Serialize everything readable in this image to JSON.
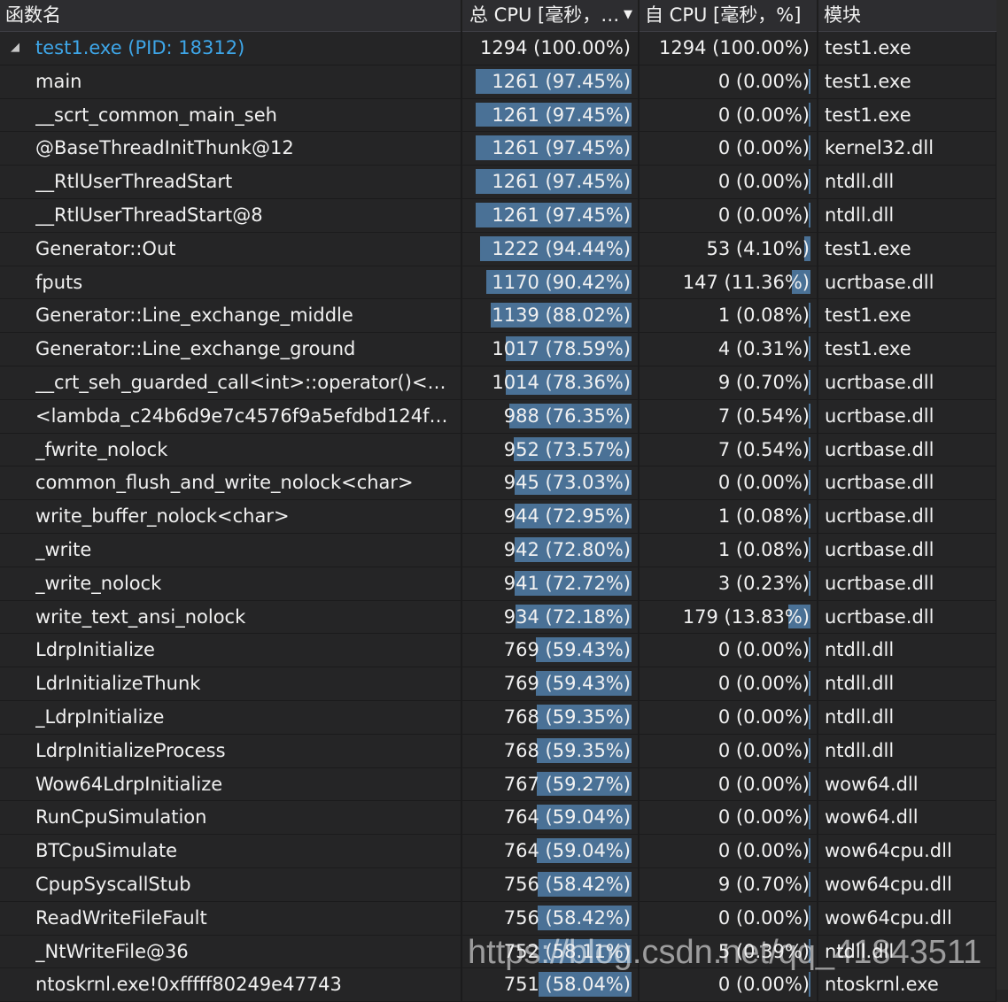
{
  "columns": {
    "name": "函数名",
    "total": "总 CPU [毫秒，…",
    "self": "自 CPU [毫秒，%]",
    "module": "模块"
  },
  "colors": {
    "bar": "#4a7196",
    "root_text": "#3ea6e8",
    "background": "#252526"
  },
  "rows": [
    {
      "name": "test1.exe (PID: 18312)",
      "total": "1294 (100.00%)",
      "total_pct": 100.0,
      "self": "1294 (100.00%)",
      "self_pct": 100.0,
      "module": "test1.exe",
      "root": true
    },
    {
      "name": "main",
      "total": "1261 (97.45%)",
      "total_pct": 97.45,
      "self": "0 (0.00%)",
      "self_pct": 0.0,
      "module": "test1.exe"
    },
    {
      "name": "__scrt_common_main_seh",
      "total": "1261 (97.45%)",
      "total_pct": 97.45,
      "self": "0 (0.00%)",
      "self_pct": 0.0,
      "module": "test1.exe"
    },
    {
      "name": "@BaseThreadInitThunk@12",
      "total": "1261 (97.45%)",
      "total_pct": 97.45,
      "self": "0 (0.00%)",
      "self_pct": 0.0,
      "module": "kernel32.dll"
    },
    {
      "name": "__RtlUserThreadStart",
      "total": "1261 (97.45%)",
      "total_pct": 97.45,
      "self": "0 (0.00%)",
      "self_pct": 0.0,
      "module": "ntdll.dll"
    },
    {
      "name": "__RtlUserThreadStart@8",
      "total": "1261 (97.45%)",
      "total_pct": 97.45,
      "self": "0 (0.00%)",
      "self_pct": 0.0,
      "module": "ntdll.dll"
    },
    {
      "name": "Generator::Out",
      "total": "1222 (94.44%)",
      "total_pct": 94.44,
      "self": "53 (4.10%)",
      "self_pct": 4.1,
      "module": "test1.exe"
    },
    {
      "name": "fputs",
      "total": "1170 (90.42%)",
      "total_pct": 90.42,
      "self": "147 (11.36%)",
      "self_pct": 11.36,
      "module": "ucrtbase.dll"
    },
    {
      "name": "Generator::Line_exchange_middle",
      "total": "1139 (88.02%)",
      "total_pct": 88.02,
      "self": "1 (0.08%)",
      "self_pct": 0.08,
      "module": "test1.exe"
    },
    {
      "name": "Generator::Line_exchange_ground",
      "total": "1017 (78.59%)",
      "total_pct": 78.59,
      "self": "4 (0.31%)",
      "self_pct": 0.31,
      "module": "test1.exe"
    },
    {
      "name": "__crt_seh_guarded_call<int>::operator()<<la...",
      "total": "1014 (78.36%)",
      "total_pct": 78.36,
      "self": "9 (0.70%)",
      "self_pct": 0.7,
      "module": "ucrtbase.dll"
    },
    {
      "name": "<lambda_c24b6d9e7c4576f9a5efdbd124f944...",
      "total": "988 (76.35%)",
      "total_pct": 76.35,
      "self": "7 (0.54%)",
      "self_pct": 0.54,
      "module": "ucrtbase.dll"
    },
    {
      "name": "_fwrite_nolock",
      "total": "952 (73.57%)",
      "total_pct": 73.57,
      "self": "7 (0.54%)",
      "self_pct": 0.54,
      "module": "ucrtbase.dll"
    },
    {
      "name": "common_flush_and_write_nolock<char>",
      "total": "945 (73.03%)",
      "total_pct": 73.03,
      "self": "0 (0.00%)",
      "self_pct": 0.0,
      "module": "ucrtbase.dll"
    },
    {
      "name": "write_buffer_nolock<char>",
      "total": "944 (72.95%)",
      "total_pct": 72.95,
      "self": "1 (0.08%)",
      "self_pct": 0.08,
      "module": "ucrtbase.dll"
    },
    {
      "name": "_write",
      "total": "942 (72.80%)",
      "total_pct": 72.8,
      "self": "1 (0.08%)",
      "self_pct": 0.08,
      "module": "ucrtbase.dll"
    },
    {
      "name": "_write_nolock",
      "total": "941 (72.72%)",
      "total_pct": 72.72,
      "self": "3 (0.23%)",
      "self_pct": 0.23,
      "module": "ucrtbase.dll"
    },
    {
      "name": "write_text_ansi_nolock",
      "total": "934 (72.18%)",
      "total_pct": 72.18,
      "self": "179 (13.83%)",
      "self_pct": 13.83,
      "module": "ucrtbase.dll"
    },
    {
      "name": "LdrpInitialize",
      "total": "769 (59.43%)",
      "total_pct": 59.43,
      "self": "0 (0.00%)",
      "self_pct": 0.0,
      "module": "ntdll.dll"
    },
    {
      "name": "LdrInitializeThunk",
      "total": "769 (59.43%)",
      "total_pct": 59.43,
      "self": "0 (0.00%)",
      "self_pct": 0.0,
      "module": "ntdll.dll"
    },
    {
      "name": "_LdrpInitialize",
      "total": "768 (59.35%)",
      "total_pct": 59.35,
      "self": "0 (0.00%)",
      "self_pct": 0.0,
      "module": "ntdll.dll"
    },
    {
      "name": "LdrpInitializeProcess",
      "total": "768 (59.35%)",
      "total_pct": 59.35,
      "self": "0 (0.00%)",
      "self_pct": 0.0,
      "module": "ntdll.dll"
    },
    {
      "name": "Wow64LdrpInitialize",
      "total": "767 (59.27%)",
      "total_pct": 59.27,
      "self": "0 (0.00%)",
      "self_pct": 0.0,
      "module": "wow64.dll"
    },
    {
      "name": "RunCpuSimulation",
      "total": "764 (59.04%)",
      "total_pct": 59.04,
      "self": "0 (0.00%)",
      "self_pct": 0.0,
      "module": "wow64.dll"
    },
    {
      "name": "BTCpuSimulate",
      "total": "764 (59.04%)",
      "total_pct": 59.04,
      "self": "0 (0.00%)",
      "self_pct": 0.0,
      "module": "wow64cpu.dll"
    },
    {
      "name": "CpupSyscallStub",
      "total": "756 (58.42%)",
      "total_pct": 58.42,
      "self": "9 (0.70%)",
      "self_pct": 0.7,
      "module": "wow64cpu.dll"
    },
    {
      "name": "ReadWriteFileFault",
      "total": "756 (58.42%)",
      "total_pct": 58.42,
      "self": "0 (0.00%)",
      "self_pct": 0.0,
      "module": "wow64cpu.dll"
    },
    {
      "name": "_NtWriteFile@36",
      "total": "752 (58.11%)",
      "total_pct": 58.11,
      "self": "5 (0.39%)",
      "self_pct": 0.39,
      "module": "ntdll.dll"
    },
    {
      "name": "ntoskrnl.exe!0xfffff80249e47743",
      "total": "751 (58.04%)",
      "total_pct": 58.04,
      "self": "0 (0.00%)",
      "self_pct": 0.0,
      "module": "ntoskrnl.exe"
    }
  ],
  "watermark": "https://blog.csdn.net/qq_41843511"
}
